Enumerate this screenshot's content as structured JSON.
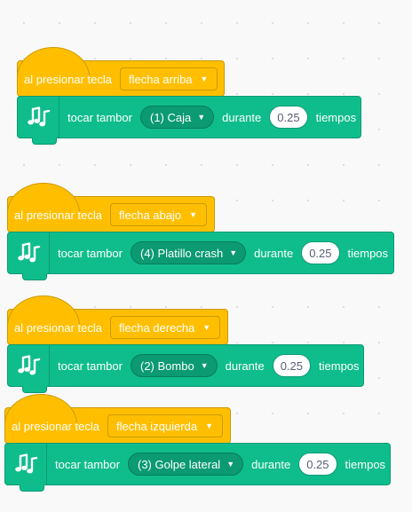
{
  "scripts": [
    {
      "hat_label": "al presionar tecla",
      "key": "flecha arriba",
      "tocar_label": "tocar tambor",
      "drum": "(1) Caja",
      "durante_label": "durante",
      "beats": "0.25",
      "tiempos_label": "tiempos"
    },
    {
      "hat_label": "al presionar tecla",
      "key": "flecha abajo",
      "tocar_label": "tocar tambor",
      "drum": "(4) Platillo crash",
      "durante_label": "durante",
      "beats": "0.25",
      "tiempos_label": "tiempos"
    },
    {
      "hat_label": "al presionar tecla",
      "key": "flecha derecha",
      "tocar_label": "tocar tambor",
      "drum": "(2) Bombo",
      "durante_label": "durante",
      "beats": "0.25",
      "tiempos_label": "tiempos"
    },
    {
      "hat_label": "al presionar tecla",
      "key": "flecha izquierda",
      "tocar_label": "tocar tambor",
      "drum": "(3) Golpe lateral",
      "durante_label": "durante",
      "beats": "0.25",
      "tiempos_label": "tiempos"
    }
  ],
  "icons": {
    "dropdown_caret": "▼",
    "extension_icon": "music-notes-icon"
  },
  "colors": {
    "events_block": "#ffbf00",
    "music_block": "#0fbd8c"
  }
}
